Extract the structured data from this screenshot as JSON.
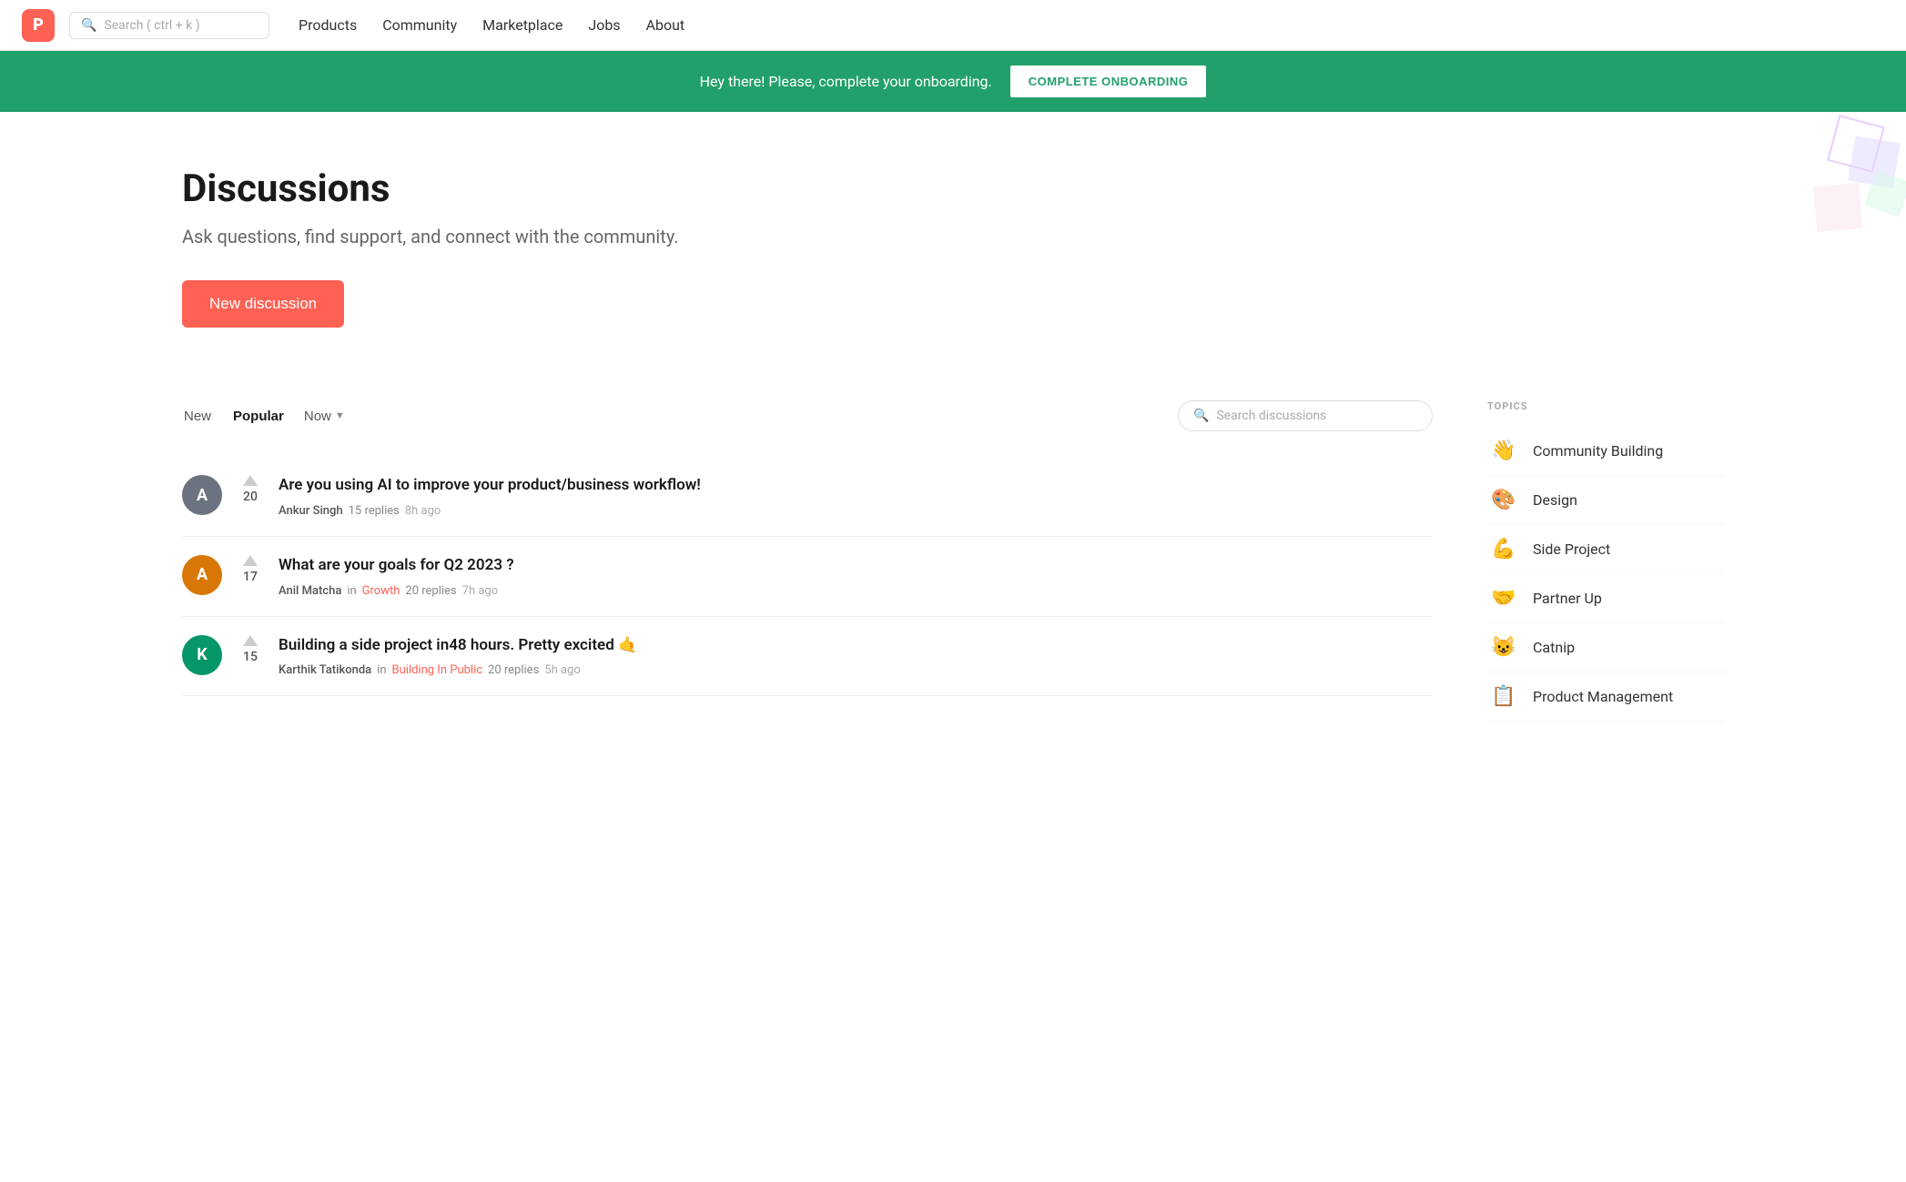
{
  "logo": {
    "letter": "P"
  },
  "search": {
    "placeholder": "Search ( ctrl + k )"
  },
  "nav": {
    "links": [
      {
        "id": "products",
        "label": "Products"
      },
      {
        "id": "community",
        "label": "Community"
      },
      {
        "id": "marketplace",
        "label": "Marketplace"
      },
      {
        "id": "jobs",
        "label": "Jobs"
      },
      {
        "id": "about",
        "label": "About"
      }
    ]
  },
  "banner": {
    "text": "Hey there! Please, complete your onboarding.",
    "button": "COMPLETE ONBOARDING"
  },
  "hero": {
    "title": "Discussions",
    "subtitle": "Ask questions, find support, and connect with the community.",
    "cta": "New discussion"
  },
  "tabs": {
    "new": "New",
    "popular": "Popular",
    "filter": "Now",
    "search_placeholder": "Search discussions"
  },
  "discussions": [
    {
      "id": 1,
      "votes": 20,
      "title": "Are you using AI to improve your product/business workflow!",
      "author": "Ankur Singh",
      "tag": null,
      "replies": "15 replies",
      "time": "8h ago",
      "avatar_color": "#6b7280",
      "avatar_letter": "A"
    },
    {
      "id": 2,
      "votes": 17,
      "title": "What are your goals for Q2 2023 ?",
      "author": "Anil Matcha",
      "tag": "Growth",
      "tag_label": "in",
      "replies": "20 replies",
      "time": "7h ago",
      "avatar_color": "#d97706",
      "avatar_letter": "A"
    },
    {
      "id": 3,
      "votes": 15,
      "title": "Building a side project in48 hours. Pretty excited 🤙",
      "author": "Karthik Tatikonda",
      "tag": "Building In Public",
      "tag_label": "in",
      "replies": "20 replies",
      "time": "5h ago",
      "avatar_color": "#059669",
      "avatar_letter": "K"
    }
  ],
  "sidebar": {
    "topics_label": "TOPICS",
    "topics": [
      {
        "id": "community-building",
        "emoji": "👋",
        "name": "Community Building"
      },
      {
        "id": "design",
        "emoji": "🎨",
        "name": "Design"
      },
      {
        "id": "side-project",
        "emoji": "💪",
        "name": "Side Project"
      },
      {
        "id": "partner-up",
        "emoji": "🤝",
        "name": "Partner Up"
      },
      {
        "id": "catnip",
        "emoji": "😺",
        "name": "Catnip"
      },
      {
        "id": "product-management",
        "emoji": "📋",
        "name": "Product Management"
      }
    ]
  }
}
